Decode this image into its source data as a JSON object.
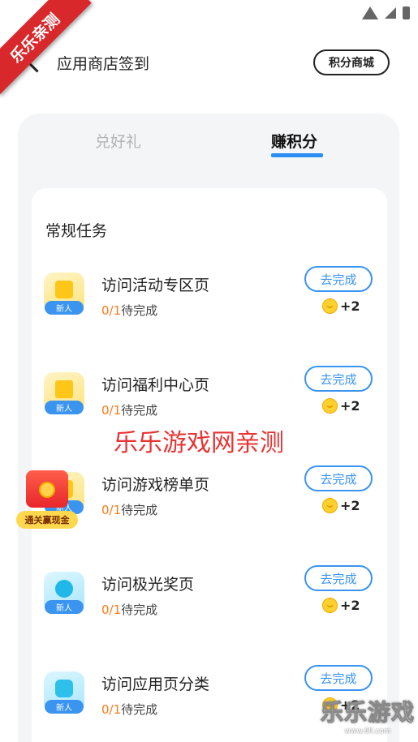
{
  "corner_ribbon": "乐乐亲测",
  "nav": {
    "title": "应用商店签到",
    "mall_button": "积分商城"
  },
  "tabs": [
    {
      "label": "兑好礼",
      "active": false
    },
    {
      "label": "赚积分",
      "active": true
    }
  ],
  "section_title": "常规任务",
  "tasks": [
    {
      "name": "访问活动专区页",
      "done": "0/1",
      "status": "待完成",
      "badge": "新人",
      "button": "去完成",
      "reward": "+2",
      "icon": "gold-box-icon"
    },
    {
      "name": "访问福利中心页",
      "done": "0/1",
      "status": "待完成",
      "badge": "新人",
      "button": "去完成",
      "reward": "+2",
      "icon": "gift-icon"
    },
    {
      "name": "访问游戏榜单页",
      "done": "0/1",
      "status": "待完成",
      "badge": "新人",
      "button": "去完成",
      "reward": "+2",
      "icon": "game-icon"
    },
    {
      "name": "访问极光奖页",
      "done": "0/1",
      "status": "待完成",
      "badge": "新人",
      "button": "去完成",
      "reward": "+2",
      "icon": "aurora-orb-icon"
    },
    {
      "name": "访问应用页分类",
      "done": "0/1",
      "status": "待完成",
      "badge": "新人",
      "button": "去完成",
      "reward": "+2",
      "icon": "category-icon"
    }
  ],
  "center_watermark": "乐乐游戏网亲测",
  "floating_packet_label": "通关赢现金",
  "brand_watermark": {
    "text": "乐乐游戏",
    "url": "www.6ll.com"
  },
  "colors": {
    "accent": "#3a94f0",
    "progress": "#ff7a18",
    "ribbon": "#d8282c"
  }
}
